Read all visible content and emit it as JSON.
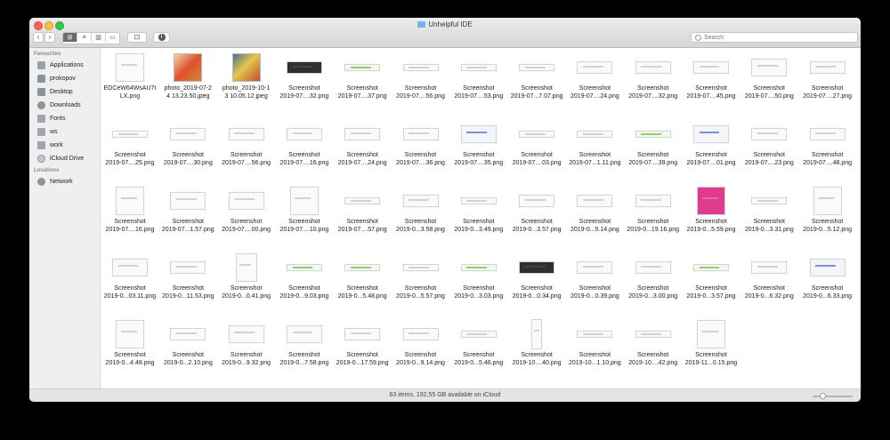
{
  "window": {
    "title": "Unhelpful IDE",
    "search_placeholder": "Search"
  },
  "toolbar": {
    "back": "‹",
    "forward": "›",
    "views": [
      "⊞",
      "≡",
      "▥",
      "▭"
    ],
    "new_folder": "⊡",
    "info": "i"
  },
  "sidebar": {
    "favourites_header": "Favourites",
    "items": [
      {
        "label": "Applications",
        "icon": "applications-icon"
      },
      {
        "label": "prokopov",
        "icon": "home-icon"
      },
      {
        "label": "Desktop",
        "icon": "desktop-icon"
      },
      {
        "label": "Downloads",
        "icon": "downloads-icon"
      },
      {
        "label": "Fonts",
        "icon": "folder-icon"
      },
      {
        "label": "ws",
        "icon": "folder-icon"
      },
      {
        "label": "work",
        "icon": "folder-icon"
      },
      {
        "label": "iCloud Drive",
        "icon": "cloud-icon"
      }
    ],
    "locations_header": "Locations",
    "locations": [
      {
        "label": "Network",
        "icon": "network-icon"
      }
    ]
  },
  "files": [
    {
      "line1": "EDCeW64WsAU7t",
      "line2": "LX.png",
      "thumb": "sq"
    },
    {
      "line1": "photo_2019-07-2",
      "line2": "4 13.23.50.jpeg",
      "thumb": "photo1"
    },
    {
      "line1": "photo_2019-10-1",
      "line2": "3 10.05.12.jpeg",
      "thumb": "photo2"
    },
    {
      "line1": "Screenshot",
      "line2": "2019-07....32.png",
      "thumb": "dark"
    },
    {
      "line1": "Screenshot",
      "line2": "2019-07....37.png",
      "thumb": "green"
    },
    {
      "line1": "Screenshot",
      "line2": "2019-07....56.png",
      "thumb": "narrow"
    },
    {
      "line1": "Screenshot",
      "line2": "2019-07....53.png",
      "thumb": "narrow"
    },
    {
      "line1": "Screenshot",
      "line2": "2019-07...7.07.png",
      "thumb": "narrow"
    },
    {
      "line1": "Screenshot",
      "line2": "2019-07....24.png",
      "thumb": "wide"
    },
    {
      "line1": "Screenshot",
      "line2": "2019-07....32.png",
      "thumb": "wide"
    },
    {
      "line1": "Screenshot",
      "line2": "2019-07....45.png",
      "thumb": "wide"
    },
    {
      "line1": "Screenshot",
      "line2": "2019-07....50.png",
      "thumb": "wide2"
    },
    {
      "line1": "Screenshot",
      "line2": "2019-07....27.png",
      "thumb": "wide"
    },
    {
      "line1": "Screenshot",
      "line2": "2019-07....25.png",
      "thumb": "narrow"
    },
    {
      "line1": "Screenshot",
      "line2": "2019-07....30.png",
      "thumb": "wide"
    },
    {
      "line1": "Screenshot",
      "line2": "2019-07....56.png",
      "thumb": "wide"
    },
    {
      "line1": "Screenshot",
      "line2": "2019-07....16.png",
      "thumb": "wide"
    },
    {
      "line1": "Screenshot",
      "line2": "2019-07....24.png",
      "thumb": "wide"
    },
    {
      "line1": "Screenshot",
      "line2": "2019-07....36.png",
      "thumb": "wide"
    },
    {
      "line1": "Screenshot",
      "line2": "2019-07....35.png",
      "thumb": "blue"
    },
    {
      "line1": "Screenshot",
      "line2": "2019-07....03.png",
      "thumb": "narrow"
    },
    {
      "line1": "Screenshot",
      "line2": "2019-07...1.11.png",
      "thumb": "narrow"
    },
    {
      "line1": "Screenshot",
      "line2": "2019-07....39.png",
      "thumb": "green"
    },
    {
      "line1": "Screenshot",
      "line2": "2019-07....01.png",
      "thumb": "blue"
    },
    {
      "line1": "Screenshot",
      "line2": "2019-07....23.png",
      "thumb": "wide"
    },
    {
      "line1": "Screenshot",
      "line2": "2019-07....48.png",
      "thumb": "wide"
    },
    {
      "line1": "Screenshot",
      "line2": "2019-07....16.png",
      "thumb": "sq"
    },
    {
      "line1": "Screenshot",
      "line2": "2019-07...1.57.png",
      "thumb": "wide2"
    },
    {
      "line1": "Screenshot",
      "line2": "2019-07....00.png",
      "thumb": "wide2"
    },
    {
      "line1": "Screenshot",
      "line2": "2019-07....10.png",
      "thumb": "sq"
    },
    {
      "line1": "Screenshot",
      "line2": "2019-07....57.png",
      "thumb": "narrow"
    },
    {
      "line1": "Screenshot",
      "line2": "2019-0...3.58.png",
      "thumb": "wide"
    },
    {
      "line1": "Screenshot",
      "line2": "2019-0...3.49.png",
      "thumb": "narrow"
    },
    {
      "line1": "Screenshot",
      "line2": "2019-0...3.57.png",
      "thumb": "wide"
    },
    {
      "line1": "Screenshot",
      "line2": "2019-0...5.14.png",
      "thumb": "wide"
    },
    {
      "line1": "Screenshot",
      "line2": "2019-0...19.16.png",
      "thumb": "wide"
    },
    {
      "line1": "Screenshot",
      "line2": "2019-0...5.59.png",
      "thumb": "pink"
    },
    {
      "line1": "Screenshot",
      "line2": "2019-0...3.31.png",
      "thumb": "narrow"
    },
    {
      "line1": "Screenshot",
      "line2": "2019-0...5.12.png",
      "thumb": "sq"
    },
    {
      "line1": "Screenshot",
      "line2": "2019-0...03.11.png",
      "thumb": "wide2"
    },
    {
      "line1": "Screenshot",
      "line2": "2019-0...11.53.png",
      "thumb": "wide"
    },
    {
      "line1": "Screenshot",
      "line2": "2019-0...0.41.png",
      "thumb": "tall"
    },
    {
      "line1": "Screenshot",
      "line2": "2019-0...9.03.png",
      "thumb": "green"
    },
    {
      "line1": "Screenshot",
      "line2": "2019-0...5.48.png",
      "thumb": "green"
    },
    {
      "line1": "Screenshot",
      "line2": "2019-0...5.57.png",
      "thumb": "narrow"
    },
    {
      "line1": "Screenshot",
      "line2": "2019-0...3.03.png",
      "thumb": "green"
    },
    {
      "line1": "Screenshot",
      "line2": "2019-0...0.34.png",
      "thumb": "dark"
    },
    {
      "line1": "Screenshot",
      "line2": "2019-0...0.39.png",
      "thumb": "wide"
    },
    {
      "line1": "Screenshot",
      "line2": "2019-0...3.00.png",
      "thumb": "wide"
    },
    {
      "line1": "Screenshot",
      "line2": "2019-0...3.57.png",
      "thumb": "green"
    },
    {
      "line1": "Screenshot",
      "line2": "2019-0...6.32.png",
      "thumb": "wide"
    },
    {
      "line1": "Screenshot",
      "line2": "2019-0...6.33.png",
      "thumb": "blue"
    },
    {
      "line1": "Screenshot",
      "line2": "2019-0...4.48.png",
      "thumb": "sq"
    },
    {
      "line1": "Screenshot",
      "line2": "2019-0...2.10.png",
      "thumb": "wide"
    },
    {
      "line1": "Screenshot",
      "line2": "2019-0...9.32.png",
      "thumb": "wide2"
    },
    {
      "line1": "Screenshot",
      "line2": "2019-0...7.58.png",
      "thumb": "wide2"
    },
    {
      "line1": "Screenshot",
      "line2": "2019-0...17.59.png",
      "thumb": "wide"
    },
    {
      "line1": "Screenshot",
      "line2": "2019-0...9.14.png",
      "thumb": "wide"
    },
    {
      "line1": "Screenshot",
      "line2": "2019-0...5.46.png",
      "thumb": "narrow"
    },
    {
      "line1": "Screenshot",
      "line2": "2019-10....40.png",
      "thumb": "tallnarrow"
    },
    {
      "line1": "Screenshot",
      "line2": "2019-10...1.10.png",
      "thumb": "narrow"
    },
    {
      "line1": "Screenshot",
      "line2": "2019-10....42.png",
      "thumb": "narrow"
    },
    {
      "line1": "Screenshot",
      "line2": "2019-11...0.15.png",
      "thumb": "sq"
    }
  ],
  "status": {
    "text": "63 items, 192,55 GB available on iCloud"
  },
  "colors": {
    "close": "#fc605b",
    "minimize": "#fdbc40",
    "zoom": "#34c84a",
    "folder_accent": "#6fb4ef"
  }
}
